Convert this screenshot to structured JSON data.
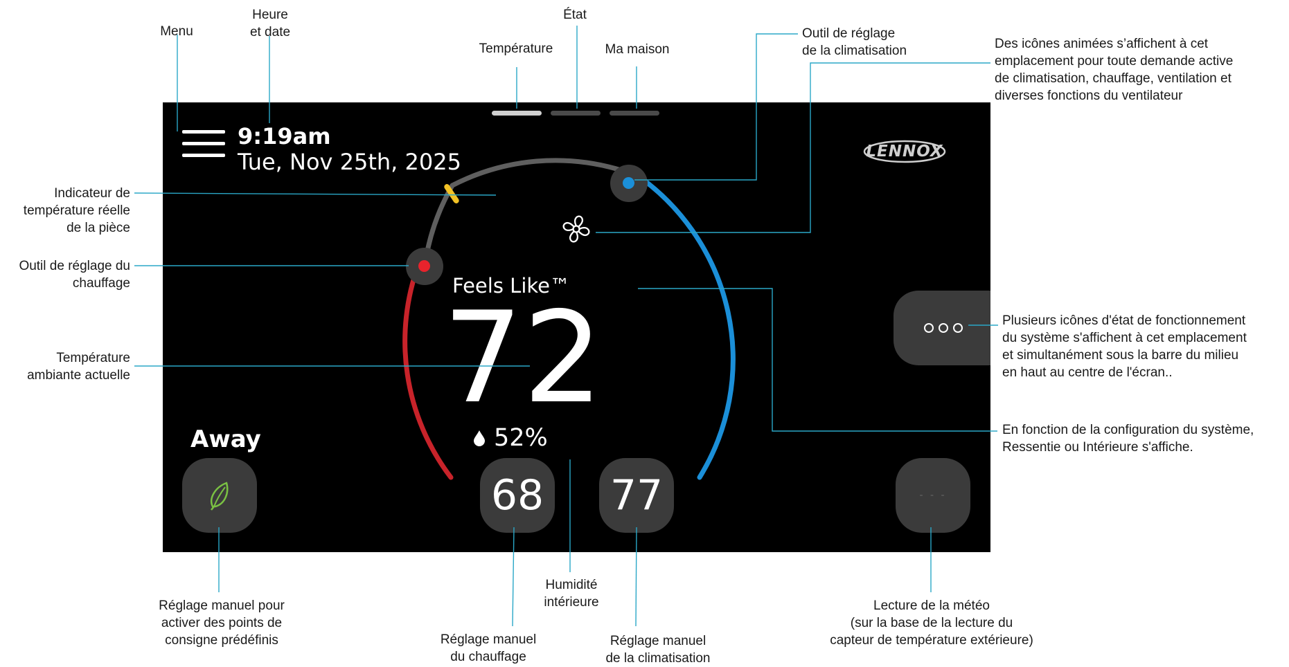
{
  "annotations": {
    "menu": "Menu",
    "time_date": [
      "Heure",
      "et date"
    ],
    "etat": "État",
    "temperature": "Température",
    "ma_maison": "Ma maison",
    "cool_tool": [
      "Outil de réglage",
      "de la climatisation"
    ],
    "animated_icons": [
      "Des icônes animées s’affichent à cet",
      "emplacement pour toute demande active",
      "de climatisation, chauffage, ventilation et",
      "diverses fonctions du ventilateur"
    ],
    "room_indicator": [
      "Indicateur de",
      "température réelle",
      "de la pièce"
    ],
    "heat_tool": [
      "Outil de réglage du",
      "chauffage"
    ],
    "ambient_temp": [
      "Température",
      "ambiante actuelle"
    ],
    "status_icons": [
      "Plusieurs icônes d'état de fonctionnement",
      "du système s'affichent à cet emplacement",
      "et simultanément sous la barre du milieu",
      "en haut au centre de l'écran.."
    ],
    "feels_like_config": [
      "En fonction de la configuration du système,",
      "Ressentie ou Intérieure s'affiche."
    ],
    "away_manual": [
      "Réglage manuel pour",
      "activer des points de",
      "consigne prédéfinis"
    ],
    "heat_manual": [
      "Réglage manuel",
      "du chauffage"
    ],
    "humidity": [
      "Humidité",
      "intérieure"
    ],
    "cool_manual": [
      "Réglage manuel",
      "de la climatisation"
    ],
    "weather": [
      "Lecture de la météo",
      "(sur la base de la lecture du",
      "capteur de température extérieure)"
    ]
  },
  "screen": {
    "time": "9:19am",
    "date": "Tue, Nov 25th, 2025",
    "brand": "LENNOX",
    "feels_like_label": "Feels Like™",
    "current_temp": "72",
    "humidity": "52%",
    "away_label": "Away",
    "heat_setpoint": "68",
    "cool_setpoint": "77",
    "weather_placeholder": "- - -",
    "active_tab_index": 0,
    "tabs": [
      "Température",
      "État",
      "Ma maison"
    ]
  },
  "icons": {
    "menu": "hamburger-icon",
    "fan": "fan-icon",
    "leaf": "leaf-icon",
    "drop": "humidity-drop-icon",
    "more": "more-dots-icon"
  },
  "colors": {
    "heat": "#e8232c",
    "heat_arc": "#c8232a",
    "cool": "#1b8fd8",
    "room_indicator": "#f2c225",
    "leaf": "#7ac143",
    "annotation_line": "#2aa7c7"
  }
}
